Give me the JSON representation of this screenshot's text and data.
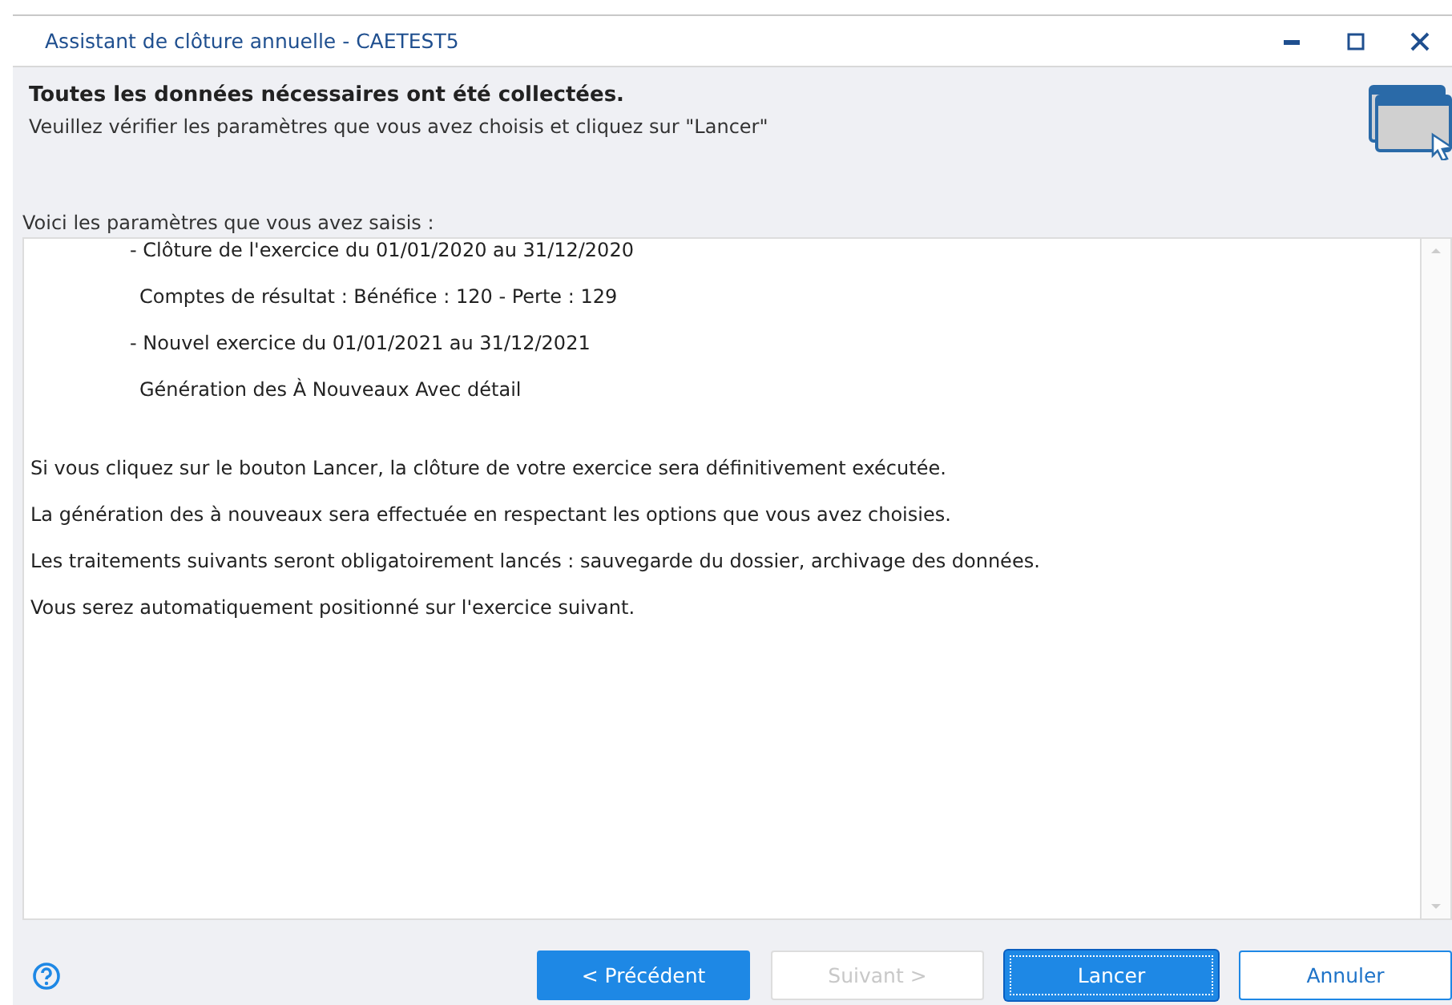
{
  "window": {
    "title": "Assistant de clôture annuelle - CAETEST5"
  },
  "header": {
    "title": "Toutes les données nécessaires ont été collectées.",
    "subtitle": "Veuillez vérifier les paramètres que vous avez choisis et cliquez sur \"Lancer\""
  },
  "intro": "Voici les paramètres que vous avez saisis :",
  "summary": [
    {
      "kind": "param",
      "text": "- Clôture de l'exercice du 01/01/2020 au 31/12/2020"
    },
    {
      "kind": "sub",
      "text": "Comptes de résultat : Bénéfice : 120 - Perte : 129"
    },
    {
      "kind": "param",
      "text": "- Nouvel exercice du 01/01/2021 au 31/12/2021"
    },
    {
      "kind": "sub",
      "text": "Génération des À Nouveaux Avec détail"
    },
    {
      "kind": "note",
      "text": "Si vous cliquez sur le bouton Lancer, la clôture de votre exercice sera définitivement exécutée."
    },
    {
      "kind": "note",
      "text": "La génération des à nouveaux sera effectuée en respectant les options que vous avez choisies."
    },
    {
      "kind": "note",
      "text": "Les traitements suivants seront obligatoirement lancés : sauvegarde du dossier, archivage des données."
    },
    {
      "kind": "note",
      "text": "Vous serez automatiquement positionné sur l'exercice suivant."
    }
  ],
  "buttons": [
    {
      "label": "< Précédent",
      "kind": "primary",
      "disabled": false,
      "focused": false
    },
    {
      "label": "Suivant >",
      "kind": "normal",
      "disabled": true,
      "focused": false
    },
    {
      "label": "Lancer",
      "kind": "primary",
      "disabled": false,
      "focused": true
    },
    {
      "label": "Annuler",
      "kind": "outline",
      "disabled": false,
      "focused": false
    }
  ]
}
